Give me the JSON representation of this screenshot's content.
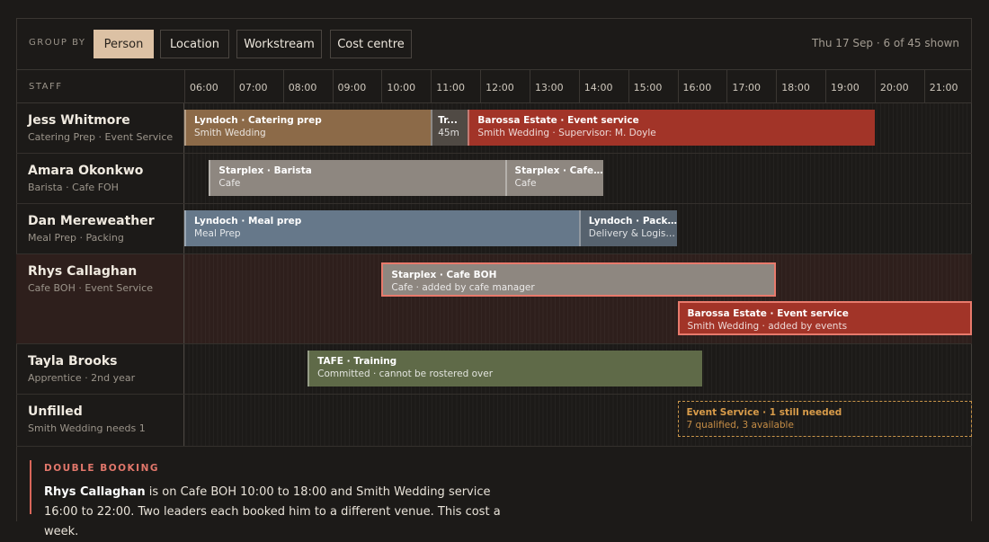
{
  "toolbar": {
    "group_by_label": "GROUP BY",
    "options": [
      "Person",
      "Location",
      "Workstream",
      "Cost centre"
    ],
    "active": "Person",
    "date_info": "Thu 17 Sep · 6 of 45 shown"
  },
  "timeline": {
    "staff_header": "STAFF",
    "hours": [
      "06:00",
      "07:00",
      "08:00",
      "09:00",
      "10:00",
      "11:00",
      "12:00",
      "13:00",
      "14:00",
      "15:00",
      "16:00",
      "17:00",
      "18:00",
      "19:00",
      "20:00",
      "21:00"
    ]
  },
  "rows": [
    {
      "name": "Jess Whitmore",
      "sub": "Catering Prep · Event Service",
      "shifts": [
        {
          "title": "Lyndoch · Catering prep",
          "detail": "Smith Wedding",
          "start": "06:00",
          "end": "11:00",
          "style": "brown"
        },
        {
          "title": "Tr...",
          "detail": "45m",
          "start": "11:00",
          "end": "11:45",
          "style": "break"
        },
        {
          "title": "Barossa Estate · Event service",
          "detail": "Smith Wedding · Supervisor: M. Doyle",
          "start": "11:45",
          "end": "20:00",
          "style": "red"
        }
      ]
    },
    {
      "name": "Amara Okonkwo",
      "sub": "Barista · Cafe FOH",
      "shifts": [
        {
          "title": "Starplex · Barista",
          "detail": "Cafe",
          "start": "06:30",
          "end": "12:30",
          "style": "grey"
        },
        {
          "title": "Starplex · Cafe F...",
          "detail": "Cafe",
          "start": "12:30",
          "end": "14:30",
          "style": "grey"
        }
      ]
    },
    {
      "name": "Dan Mereweather",
      "sub": "Meal Prep · Packing",
      "shifts": [
        {
          "title": "Lyndoch · Meal prep",
          "detail": "Meal Prep",
          "start": "06:00",
          "end": "14:00",
          "style": "blue"
        },
        {
          "title": "Lyndoch · Packin...",
          "detail": "Delivery & Logist...",
          "start": "14:00",
          "end": "16:00",
          "style": "bluegrey"
        }
      ]
    },
    {
      "name": "Rhys Callaghan",
      "sub": "Cafe BOH · Event Service",
      "conflict": true,
      "shifts": [
        {
          "title": "Starplex · Cafe BOH",
          "detail": "Cafe · added by cafe manager",
          "start": "10:00",
          "end": "18:00",
          "style": "greyout"
        },
        {
          "title": "Barossa Estate · Event service",
          "detail": "Smith Wedding · added by events",
          "start": "16:00",
          "end": "22:00",
          "style": "redout"
        }
      ]
    },
    {
      "name": "Tayla Brooks",
      "sub": "Apprentice · 2nd year",
      "shifts": [
        {
          "title": "TAFE · Training",
          "detail": "Committed · cannot be rostered over",
          "start": "08:30",
          "end": "16:30",
          "style": "green"
        }
      ]
    },
    {
      "name": "Unfilled",
      "sub": "Smith Wedding needs 1",
      "shifts": [
        {
          "title": "Event Service · 1 still needed",
          "detail": "7 qualified, 3 available",
          "start": "16:00",
          "end": "22:00",
          "style": "unfilled"
        }
      ]
    }
  ],
  "alert": {
    "title": "DOUBLE BOOKING",
    "person": "Rhys Callaghan",
    "text": " is on Cafe BOH 10:00 to 18:00 and Smith Wedding service 16:00 to 22:00. Two leaders each booked him to a different venue. This cost a week."
  },
  "colors": {
    "accent": "#dcc1a4",
    "conflict": "#e87a6c",
    "unfilled": "#c9954a"
  }
}
